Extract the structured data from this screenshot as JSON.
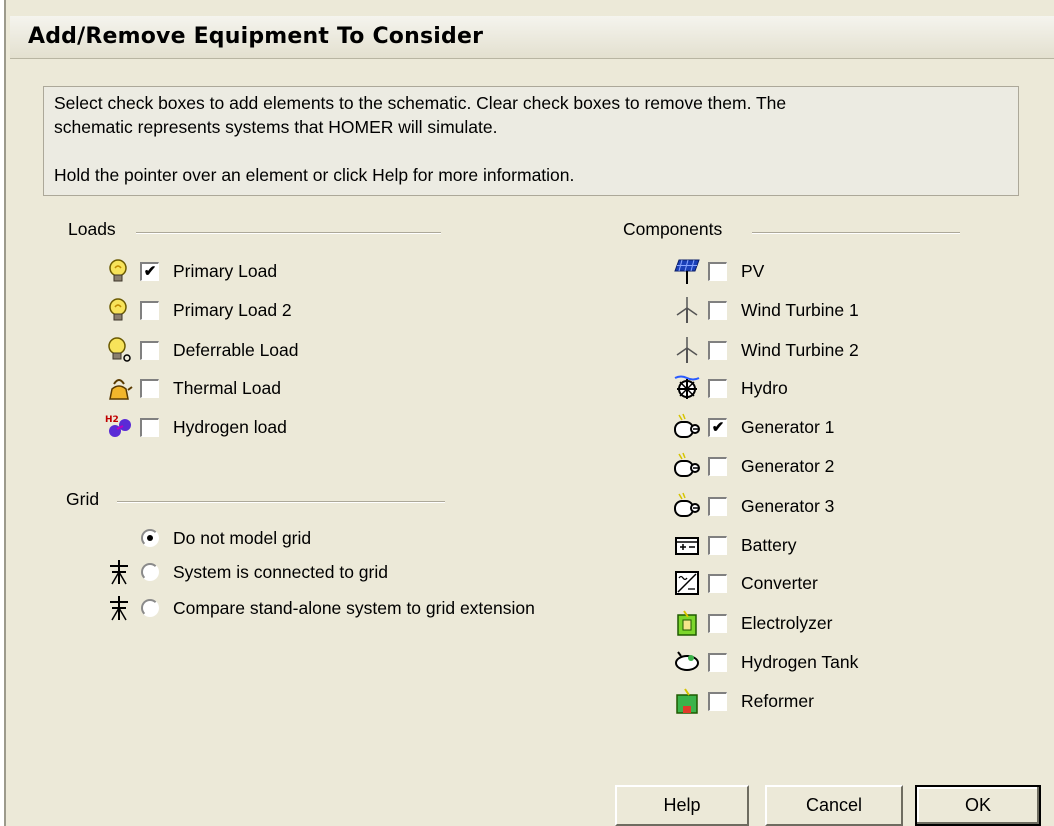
{
  "dialog": {
    "title": "Add/Remove Equipment To Consider"
  },
  "info": {
    "line1": "Select check boxes to add elements to the schematic. Clear check boxes to remove them. The",
    "line2": "schematic represents systems that HOMER will simulate.",
    "line3": "Hold the pointer over an element or click Help for more information."
  },
  "loads": {
    "label": "Loads",
    "items": [
      {
        "label": "Primary Load",
        "checked": true,
        "icon": "lightbulb-icon"
      },
      {
        "label": "Primary Load 2",
        "checked": false,
        "icon": "lightbulb-icon"
      },
      {
        "label": "Deferrable Load",
        "checked": false,
        "icon": "deferrable-lightbulb-icon"
      },
      {
        "label": "Thermal Load",
        "checked": false,
        "icon": "kettle-icon"
      },
      {
        "label": "Hydrogen load",
        "checked": false,
        "icon": "hydrogen-molecule-icon"
      }
    ]
  },
  "grid": {
    "label": "Grid",
    "options": [
      {
        "label": "Do not model grid",
        "selected": true,
        "icon": ""
      },
      {
        "label": "System is connected to grid",
        "selected": false,
        "icon": "power-tower-icon"
      },
      {
        "label": "Compare stand-alone system to grid extension",
        "selected": false,
        "icon": "power-tower-icon"
      }
    ]
  },
  "components": {
    "label": "Components",
    "items": [
      {
        "label": "PV",
        "checked": false,
        "icon": "solar-panel-icon"
      },
      {
        "label": "Wind Turbine 1",
        "checked": false,
        "icon": "wind-turbine-icon"
      },
      {
        "label": "Wind Turbine 2",
        "checked": false,
        "icon": "wind-turbine-icon"
      },
      {
        "label": "Hydro",
        "checked": false,
        "icon": "hydro-turbine-icon"
      },
      {
        "label": "Generator 1",
        "checked": true,
        "icon": "generator-icon"
      },
      {
        "label": "Generator 2",
        "checked": false,
        "icon": "generator-icon"
      },
      {
        "label": "Generator 3",
        "checked": false,
        "icon": "generator-icon"
      },
      {
        "label": "Battery",
        "checked": false,
        "icon": "battery-icon"
      },
      {
        "label": "Converter",
        "checked": false,
        "icon": "converter-icon"
      },
      {
        "label": "Electrolyzer",
        "checked": false,
        "icon": "electrolyzer-icon"
      },
      {
        "label": "Hydrogen Tank",
        "checked": false,
        "icon": "hydrogen-tank-icon"
      },
      {
        "label": "Reformer",
        "checked": false,
        "icon": "reformer-icon"
      }
    ]
  },
  "buttons": {
    "help": "Help",
    "cancel": "Cancel",
    "ok": "OK"
  }
}
